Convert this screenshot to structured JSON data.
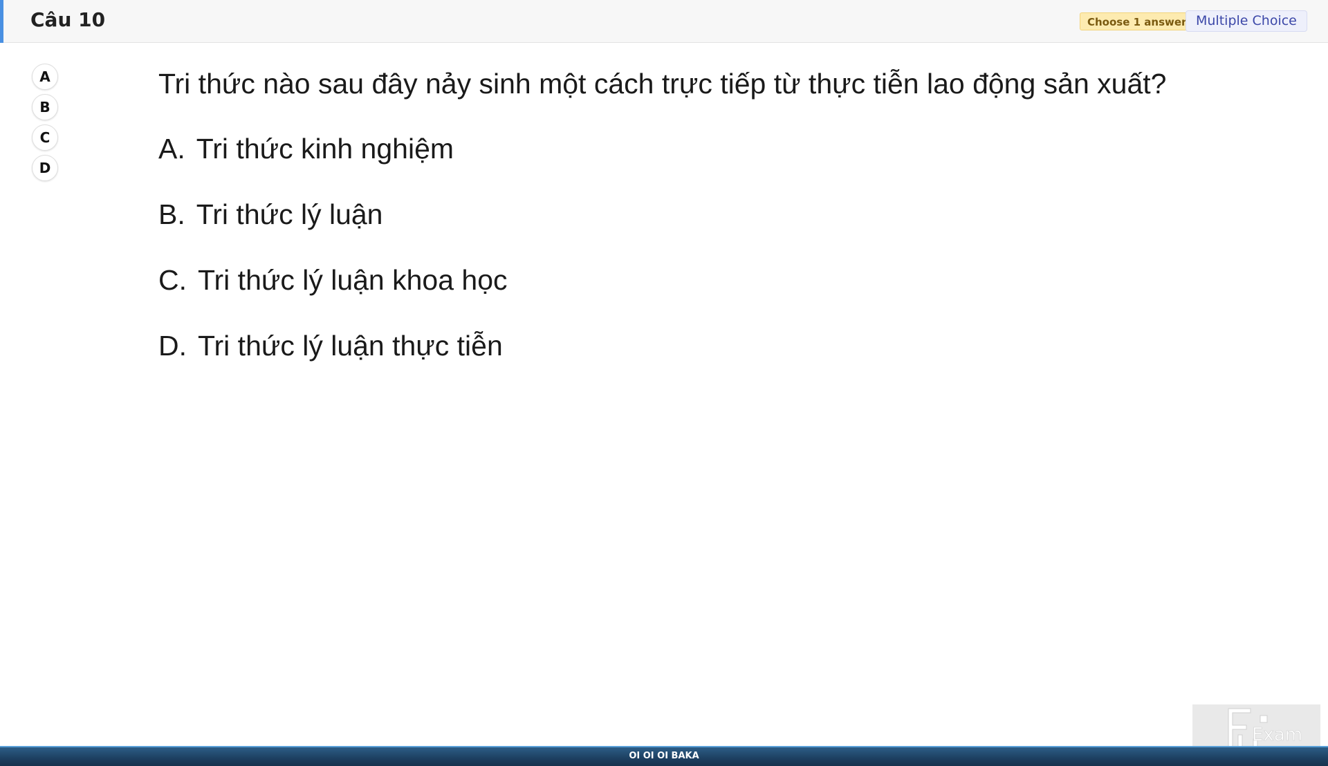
{
  "header": {
    "title": "Câu 10",
    "badge_choose": "Choose 1 answer",
    "badge_type": "Multiple Choice",
    "accent_color": "#4a90e2"
  },
  "selector": {
    "options": [
      "A",
      "B",
      "C",
      "D"
    ]
  },
  "question": {
    "stem": "Tri thức nào sau đây nảy sinh một cách trực tiếp từ thực tiễn lao động sản xuất?",
    "options": [
      {
        "letter": "A.",
        "text": "Tri thức kinh nghiệm"
      },
      {
        "letter": "B.",
        "text": "Tri thức lý luận"
      },
      {
        "letter": "C.",
        "text": "Tri thức lý luận khoa học"
      },
      {
        "letter": "D.",
        "text": "Tri thức lý luận thực tiễn"
      }
    ]
  },
  "logo": {
    "icon": "fu-exam-logo",
    "text": "Exam"
  },
  "footer": {
    "text": "OI OI OI BAKA"
  }
}
